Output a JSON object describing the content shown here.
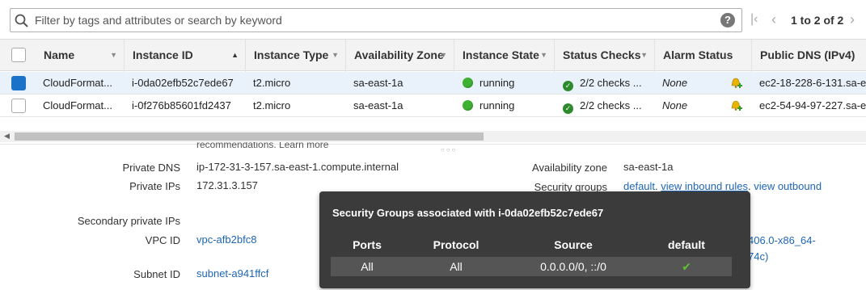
{
  "filter": {
    "placeholder": "Filter by tags and attributes or search by keyword",
    "help": "?",
    "pagination": "1 to 2 of 2"
  },
  "columns": [
    {
      "label": "Name"
    },
    {
      "label": "Instance ID"
    },
    {
      "label": "Instance Type"
    },
    {
      "label": "Availability Zone"
    },
    {
      "label": "Instance State"
    },
    {
      "label": "Status Checks"
    },
    {
      "label": "Alarm Status"
    },
    {
      "label": "Public DNS (IPv4)"
    }
  ],
  "rows": [
    {
      "name": "CloudFormat...",
      "instance_id": "i-0da02efb52c7ede67",
      "type": "t2.micro",
      "zone": "sa-east-1a",
      "state": "running",
      "checks": "2/2 checks ...",
      "alarm": "None",
      "dns": "ec2-18-228-6-131.sa-e",
      "selected": true
    },
    {
      "name": "CloudFormat...",
      "instance_id": "i-0f276b85601fd2437",
      "type": "t2.micro",
      "zone": "sa-east-1a",
      "state": "running",
      "checks": "2/2 checks ...",
      "alarm": "None",
      "dns": "ec2-54-94-97-227.sa-e",
      "selected": false
    }
  ],
  "details": {
    "cut_text": "recommendations. Learn more",
    "private_dns_label": "Private DNS",
    "private_dns": "ip-172-31-3-157.sa-east-1.compute.internal",
    "private_ips_label": "Private IPs",
    "private_ips": "172.31.3.157",
    "secondary_ips_label": "Secondary private IPs",
    "vpc_label": "VPC ID",
    "vpc": "vpc-afb2bfc8",
    "subnet_label": "Subnet ID",
    "subnet": "subnet-a941ffcf",
    "az_label": "Availability zone",
    "az": "sa-east-1a",
    "sg_label": "Security groups",
    "sg_default": "default",
    "sg_inbound": "view inbound rules",
    "sg_outbound": "view outbound",
    "ami_partial_1": "406.0-x86_64-",
    "ami_partial_2": "74c)"
  },
  "popover": {
    "title": "Security Groups associated with i-0da02efb52c7ede67",
    "headers": [
      "Ports",
      "Protocol",
      "Source",
      "default"
    ],
    "row": {
      "ports": "All",
      "protocol": "All",
      "source": "0.0.0.0/0, ::/0"
    }
  },
  "colors": {
    "selected_row": "#e9f2fb",
    "link": "#1e66b5",
    "running": "#3fb132",
    "popover_bg": "#3b3b3b"
  }
}
